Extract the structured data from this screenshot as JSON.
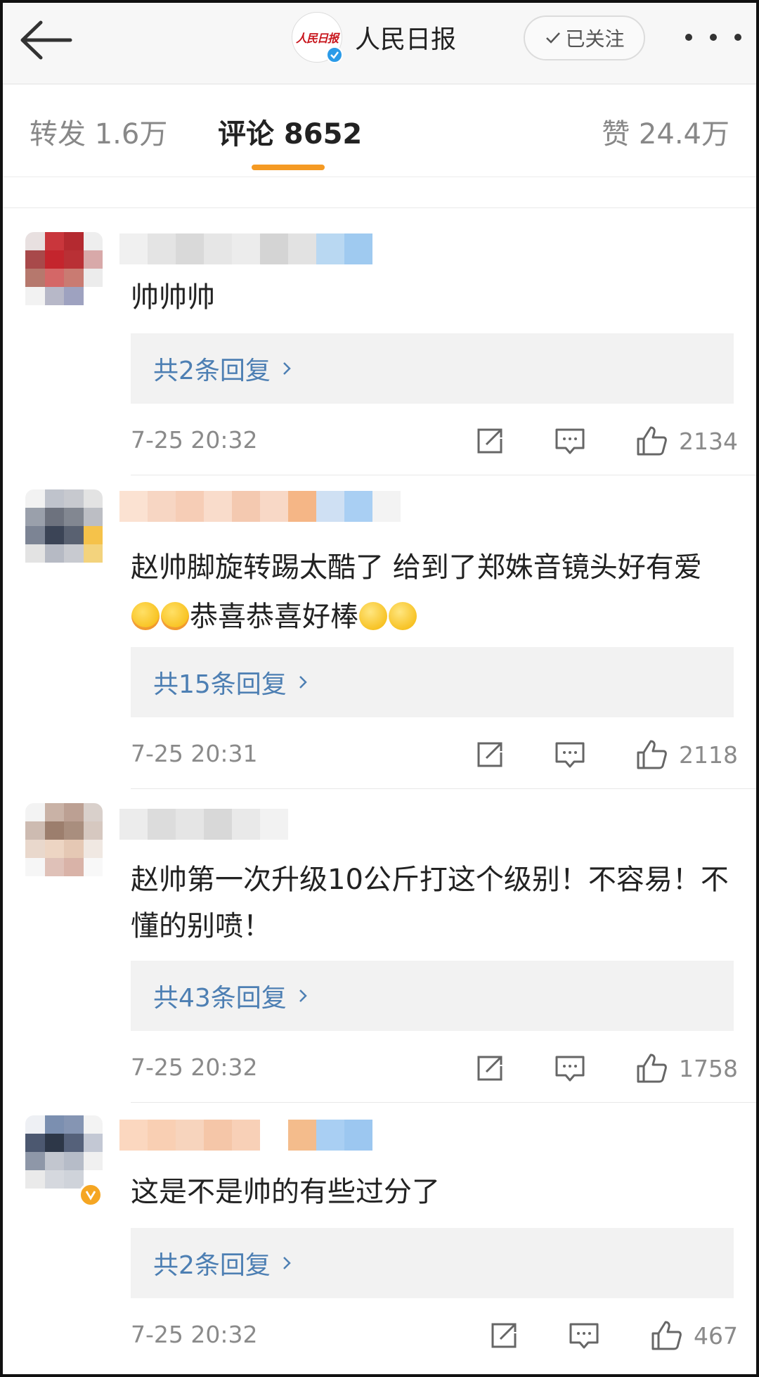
{
  "header": {
    "account_name": "人民日报",
    "logo_text": "人民日报",
    "follow_label": "已关注"
  },
  "tabs": [
    {
      "label": "转发 1.6万",
      "active": false
    },
    {
      "label": "评论 8652",
      "active": true
    },
    {
      "label": "赞 24.4万",
      "active": false
    }
  ],
  "comments": [
    {
      "text": "帅帅帅",
      "reply_label": "共2条回复",
      "time": "7-25 20:32",
      "likes": "2134"
    },
    {
      "text_part1": "赵帅脚旋转踢太酷了 给到了郑姝音镜头好有爱",
      "text_part2": "恭喜恭喜好棒",
      "reply_label": "共15条回复",
      "time": "7-25 20:31",
      "likes": "2118"
    },
    {
      "text": "赵帅第一次升级10公斤打这个级别！不容易！不懂的别喷！",
      "reply_label": "共43条回复",
      "time": "7-25 20:32",
      "likes": "1758"
    },
    {
      "text": "这是不是帅的有些过分了",
      "reply_label": "共2条回复",
      "time": "7-25 20:32",
      "likes": "467"
    }
  ],
  "icons": {
    "back": "back-arrow-icon",
    "verified": "verified-check-icon",
    "follow_check": "check-icon",
    "more": "more-dots-icon",
    "repost": "repost-icon",
    "comment": "comment-icon",
    "like": "thumbs-up-icon"
  },
  "colors": {
    "accent_underline": "#f59a23",
    "reply_link": "#4d7fb3",
    "verified_blue": "#2b9be8",
    "vip_orange": "#f5a623"
  }
}
